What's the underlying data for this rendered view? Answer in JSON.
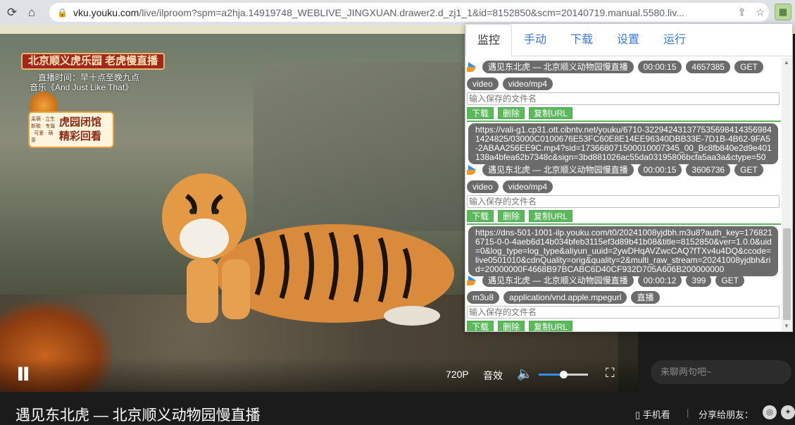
{
  "browser": {
    "url_host": "vku.youku.com",
    "url_path": "/live/ilproom?spm=a2hja.14919748_WEBLIVE_JINGXUAN.drawer2.d_zj1_1&id=8152850&scm=20140719.manual.5580.liv..."
  },
  "video": {
    "badge_title": "北京顺义虎乐园 老虎慢直播",
    "subtitle_time": "直播时间：早十点至晚九点",
    "subtitle_music": "音乐《And Just Like That》",
    "promo_big": "虎园闭馆\n精彩回看",
    "promo_small": "呆萌 · 立生新歌 · 专属 · 可爱 · 萌芽",
    "controls": {
      "resolution": "720P",
      "effects": "音效",
      "volume_level": 0.5
    },
    "title": "遇见东北虎 — 北京顺义动物园慢直播",
    "mobile_watch": "手机看",
    "share_label": "分享给朋友：",
    "chat_placeholder": "来聊两句吧~"
  },
  "panel": {
    "tabs": [
      {
        "label": "监控",
        "active": true
      },
      {
        "label": "手动",
        "active": false
      },
      {
        "label": "下载",
        "active": false
      },
      {
        "label": "设置",
        "active": false
      },
      {
        "label": "运行",
        "active": false
      }
    ],
    "filename_placeholder": "输入保存的文件名",
    "buttons": {
      "download": "下载",
      "delete": "删除",
      "copy": "复制URL"
    },
    "entries": [
      {
        "title": "遇见东北虎 — 北京顺义动物园慢直播",
        "duration": "00:00:15",
        "size": "4657385",
        "method": "GET",
        "tags": [
          "video",
          "video/mp4"
        ],
        "url": "https://vali-g1.cp31.ott.cibntv.net/youku/6710-322942431377535698414356984 1424825/03000C0100676E53FC60E8E14EE96340DBB33E-7D1B-4B62-9FA5-2ABAA256EE9C.mp4?sid=173668071500010007345_00_Bc8fb840e2d9e401138a4bfea62b7348c&sign=3bd881026ac55da03195806bcfa5aa3a&ctype=50"
      },
      {
        "title": "遇见东北虎 — 北京顺义动物园慢直播",
        "duration": "00:00:15",
        "size": "3606736",
        "method": "GET",
        "tags": [
          "video",
          "video/mp4"
        ],
        "url": "https://dns-501-1001-ilp.youku.com/t0/20241008yjdbh.m3u8?auth_key=1768216715-0-0-4aeb6d14b034bfeb3115ef3d89b41b08&title=8152850&ver=1.0.0&uid=0&log_type=log_type&aliyun_uuid=2ywDHqAVZwcCAQ7fTXv4u4DQ&ccode=live0501010&cdnQuality=orig&quality=2&multi_raw_stream=20241008yjdbh&rid=20000000F4668B97BCABC6D40CF932D705A606B200000000"
      },
      {
        "title": "遇见东北虎 — 北京顺义动物园慢直播",
        "duration": "00:00:12",
        "size": "399",
        "method": "GET",
        "tags": [
          "m3u8",
          "application/vnd.apple.mpegurl",
          "直播"
        ]
      }
    ]
  }
}
